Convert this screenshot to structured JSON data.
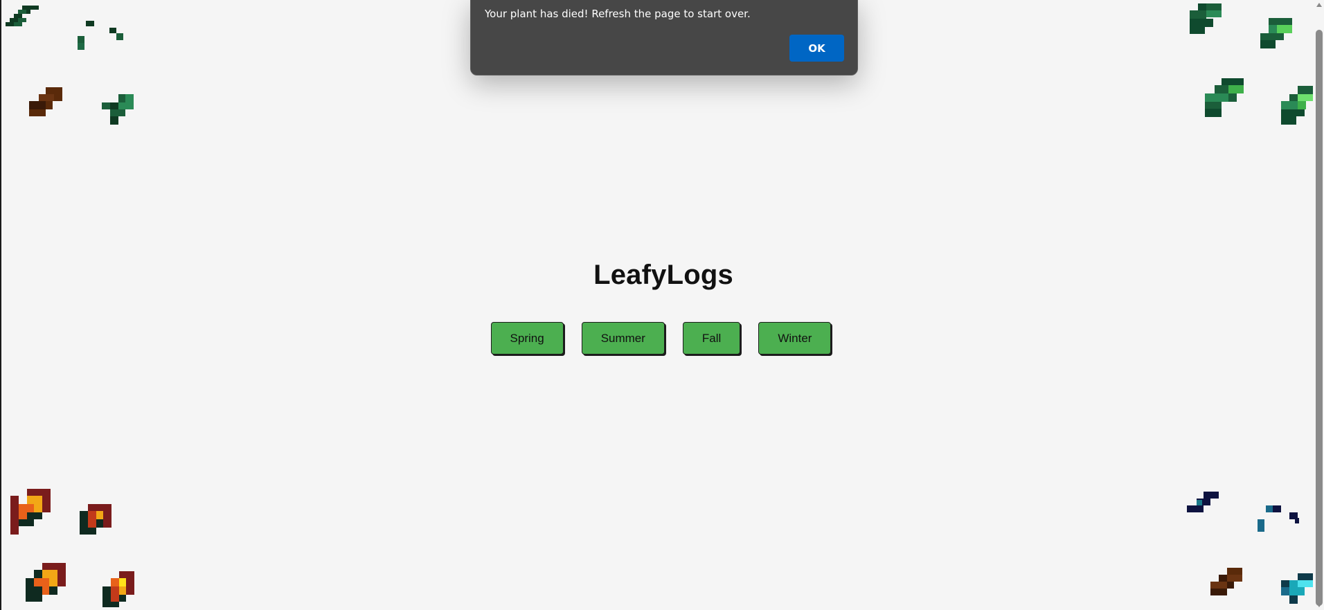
{
  "app": {
    "title": "LeafyLogs"
  },
  "seasons": {
    "buttons": [
      {
        "label": "Spring"
      },
      {
        "label": "Summer"
      },
      {
        "label": "Fall"
      },
      {
        "label": "Winter"
      }
    ]
  },
  "dialog": {
    "message": "Your plant has died! Refresh the page to start over.",
    "ok_label": "OK"
  },
  "theme": {
    "background": "#f5f5f5",
    "button_green": "#4caf50",
    "dialog_bg": "#474747",
    "dialog_ok": "#0066c4"
  },
  "decorations": {
    "top_left": "spring-leaf-icons",
    "top_right": "summer-leaf-icons",
    "bottom_left": "fall-leaf-icons",
    "bottom_right": "winter-leaf-icons"
  }
}
